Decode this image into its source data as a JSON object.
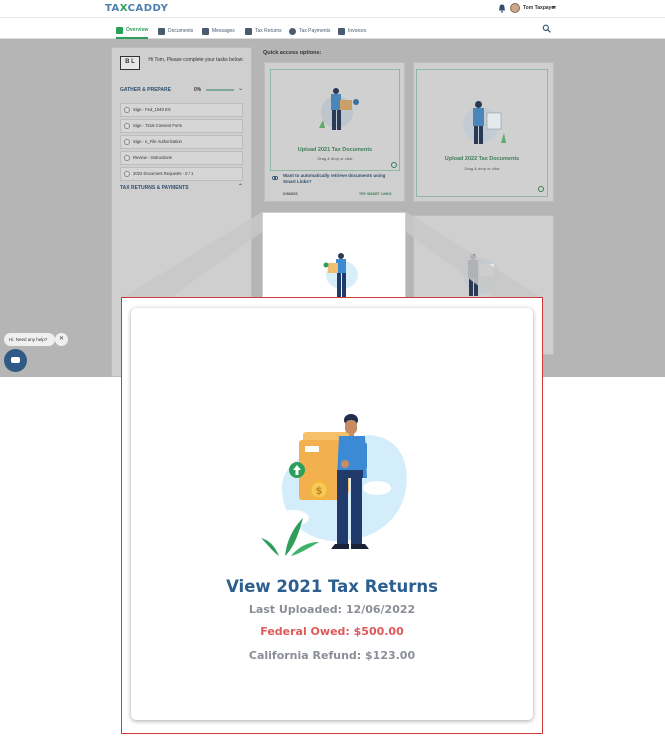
{
  "header": {
    "logo_left": "TA",
    "logo_x": "X",
    "logo_right": "CADDY",
    "user_name": "Tom Taxpayer",
    "user_chevron": "▾"
  },
  "nav": {
    "tabs": [
      {
        "label": "Overview"
      },
      {
        "label": "Documents"
      },
      {
        "label": "Messages"
      },
      {
        "label": "Tax Returns"
      },
      {
        "label": "Tax Payments"
      },
      {
        "label": "Invoices"
      }
    ]
  },
  "sidebar": {
    "company_logo": "B L",
    "greeting": "Hi Tom, Please complete your tasks below:",
    "gather_title": "GATHER & PREPARE",
    "gather_percent": "0%",
    "gather_progress": 0,
    "tasks": [
      {
        "label": "Sign - Fed_1040 ES"
      },
      {
        "label": "Sign - 7216 Consent Form"
      },
      {
        "label": "Sign - e_File Authorization"
      },
      {
        "label": "Review - Instructions"
      },
      {
        "label": "2022 Document Requests - 0 / 1"
      }
    ],
    "returns_title": "TAX RETURNS & PAYMENTS"
  },
  "quick_access": {
    "title": "Quick access options:",
    "upload_2021": {
      "title": "Upload 2021 Tax Documents",
      "sub": "Drag & drop or click"
    },
    "upload_2022": {
      "title": "Upload 2022 Tax Documents",
      "sub": "Drag & drop or click"
    },
    "smart_links": {
      "question": "Want to automatically retrieve documents using Smart Links?",
      "dismiss": "DISMISS",
      "try": "TRY SMART LINKS"
    }
  },
  "help": {
    "bubble": "Hi. Need any help?",
    "close": "✕"
  },
  "zoom_card": {
    "title": "View 2021 Tax Returns",
    "last_uploaded": "Last Uploaded: 12/06/2022",
    "federal": "Federal Owed: $500.00",
    "california": "California Refund: $123.00"
  },
  "colors": {
    "accent_green": "#2e9e5b",
    "title_blue": "#2c5f8f",
    "owed_red": "#e05858",
    "muted_gray": "#8a8f96",
    "callout_border": "#d23b3b"
  }
}
